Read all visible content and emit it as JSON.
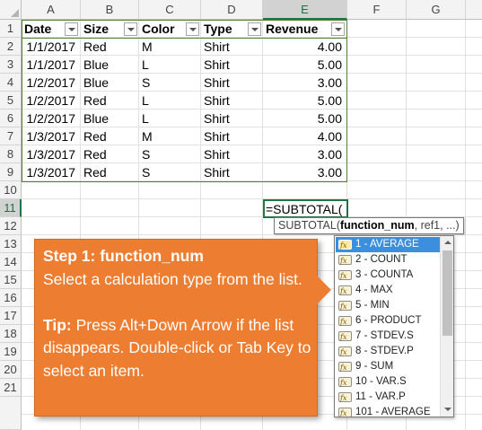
{
  "columns": [
    "A",
    "B",
    "C",
    "D",
    "E",
    "F",
    "G"
  ],
  "selected_column": "E",
  "rows": [
    "1",
    "2",
    "3",
    "4",
    "5",
    "6",
    "7",
    "8",
    "9",
    "10",
    "11",
    "12",
    "13",
    "14",
    "15",
    "16",
    "17",
    "18",
    "19",
    "20",
    "21"
  ],
  "selected_row": "11",
  "table": {
    "headers": [
      "Date",
      "Size",
      "Color",
      "Type",
      "Revenue"
    ],
    "rows": [
      [
        "1/1/2017",
        "Red",
        "M",
        "Shirt",
        "4.00"
      ],
      [
        "1/1/2017",
        "Blue",
        "L",
        "Shirt",
        "5.00"
      ],
      [
        "1/2/2017",
        "Blue",
        "S",
        "Shirt",
        "3.00"
      ],
      [
        "1/2/2017",
        "Red",
        "L",
        "Shirt",
        "5.00"
      ],
      [
        "1/2/2017",
        "Blue",
        "L",
        "Shirt",
        "5.00"
      ],
      [
        "1/3/2017",
        "Red",
        "M",
        "Shirt",
        "4.00"
      ],
      [
        "1/3/2017",
        "Red",
        "S",
        "Shirt",
        "3.00"
      ],
      [
        "1/3/2017",
        "Red",
        "S",
        "Shirt",
        "3.00"
      ]
    ]
  },
  "active_cell": {
    "formula": "=SUBTOTAL("
  },
  "tooltip": {
    "func": "SUBTOTAL(",
    "arg_bold": "function_num",
    "rest": ", ref1, ...)"
  },
  "dropdown": {
    "items": [
      "1 - AVERAGE",
      "2 - COUNT",
      "3 - COUNTA",
      "4 - MAX",
      "5 - MIN",
      "6 - PRODUCT",
      "7 - STDEV.S",
      "8 - STDEV.P",
      "9 - SUM",
      "10 - VAR.S",
      "11 - VAR.P",
      "101 - AVERAGE"
    ],
    "selected_index": 0
  },
  "callout": {
    "step_title": "Step 1: function_num",
    "step_text": "Select a calculation type from the list.",
    "tip_label": "Tip:",
    "tip_text": " Press Alt+Down Arrow if the list disappears.  Double-click or Tab Key to select an item.",
    "color": "#ed7d31"
  },
  "colors": {
    "excel_green": "#217346",
    "table_border": "#538135",
    "selection_blue": "#3c8fdc"
  }
}
